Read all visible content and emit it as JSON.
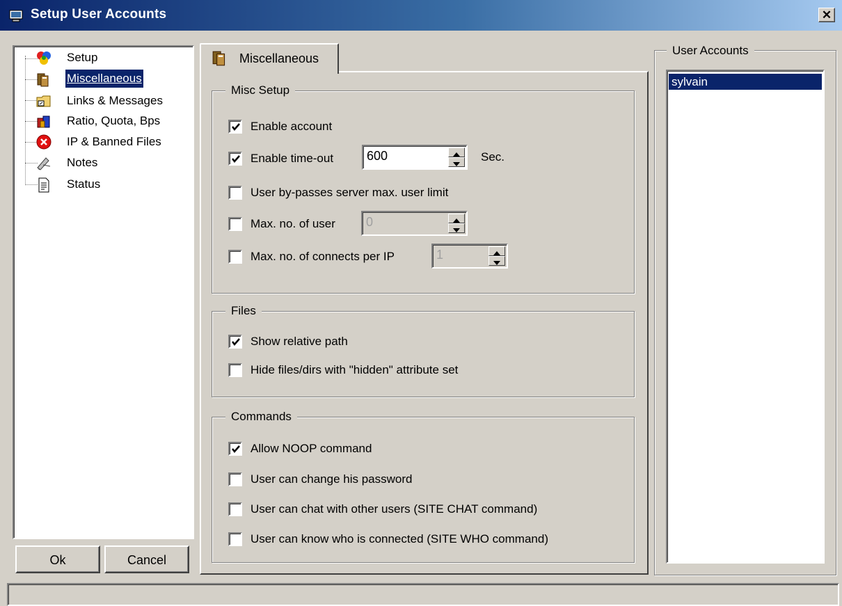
{
  "window": {
    "title": "Setup User Accounts",
    "close_label": "✕"
  },
  "tree": {
    "items": [
      {
        "label": "Setup",
        "icon": "setup-icon"
      },
      {
        "label": "Miscellaneous",
        "icon": "miscellaneous-icon",
        "selected": true
      },
      {
        "label": "Links & Messages",
        "icon": "folder-link-icon"
      },
      {
        "label": "Ratio, Quota, Bps",
        "icon": "ratio-quota-icon"
      },
      {
        "label": "IP & Banned Files",
        "icon": "banned-icon"
      },
      {
        "label": "Notes",
        "icon": "notes-icon"
      },
      {
        "label": "Status",
        "icon": "status-icon"
      }
    ]
  },
  "buttons": {
    "ok": "Ok",
    "cancel": "Cancel"
  },
  "tab": {
    "label": "Miscellaneous"
  },
  "misc_setup": {
    "title": "Misc Setup",
    "enable_account": "Enable account",
    "enable_timeout": "Enable time-out",
    "timeout_value": "600",
    "timeout_unit": "Sec.",
    "bypass_limit": "User by-passes server max. user limit",
    "max_users": "Max. no. of user",
    "max_users_value": "0",
    "max_connects": "Max. no. of connects per IP",
    "max_connects_value": "1"
  },
  "files": {
    "title": "Files",
    "show_relative": "Show relative path",
    "hide_hidden": "Hide files/dirs with \"hidden\" attribute set"
  },
  "commands": {
    "title": "Commands",
    "allow_noop": "Allow NOOP command",
    "change_password": "User can change his password",
    "chat": "User can chat with other users (SITE CHAT command)",
    "know_who": "User can know who is connected (SITE WHO command)"
  },
  "user_accounts": {
    "title": "User Accounts",
    "users": [
      "sylvain"
    ]
  },
  "state": {
    "enable_account": true,
    "enable_timeout": true,
    "bypass_limit": false,
    "max_users": false,
    "max_connects": false,
    "show_relative": true,
    "hide_hidden": false,
    "allow_noop": true,
    "change_password": false,
    "chat": false,
    "know_who": false
  },
  "colors": {
    "face": "#d4d0c8",
    "selection": "#0a246a",
    "title_start": "#0a246a",
    "title_end": "#a6caf0"
  }
}
